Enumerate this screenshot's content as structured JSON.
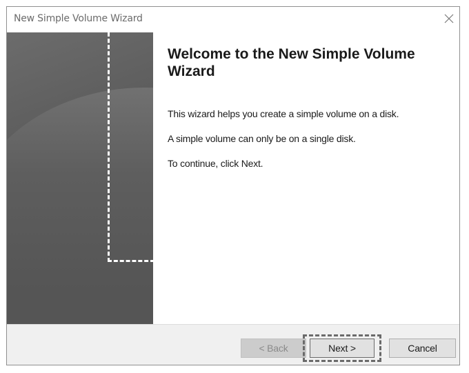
{
  "window": {
    "title": "New Simple Volume Wizard"
  },
  "content": {
    "heading": "Welcome to the New Simple Volume Wizard",
    "paragraphs": [
      "This wizard helps you create a simple volume on a disk.",
      "A simple volume can only be on a single disk.",
      "To continue, click Next."
    ]
  },
  "footer": {
    "back_label": "< Back",
    "next_label": "Next >",
    "cancel_label": "Cancel"
  },
  "icons": {
    "close": "close-icon"
  },
  "colors": {
    "sidebar": "#5a5a5a",
    "footer_bg": "#f0f0f0",
    "highlight_outline": "#6a6a6a"
  },
  "state": {
    "back_enabled": false,
    "next_highlighted": true
  }
}
